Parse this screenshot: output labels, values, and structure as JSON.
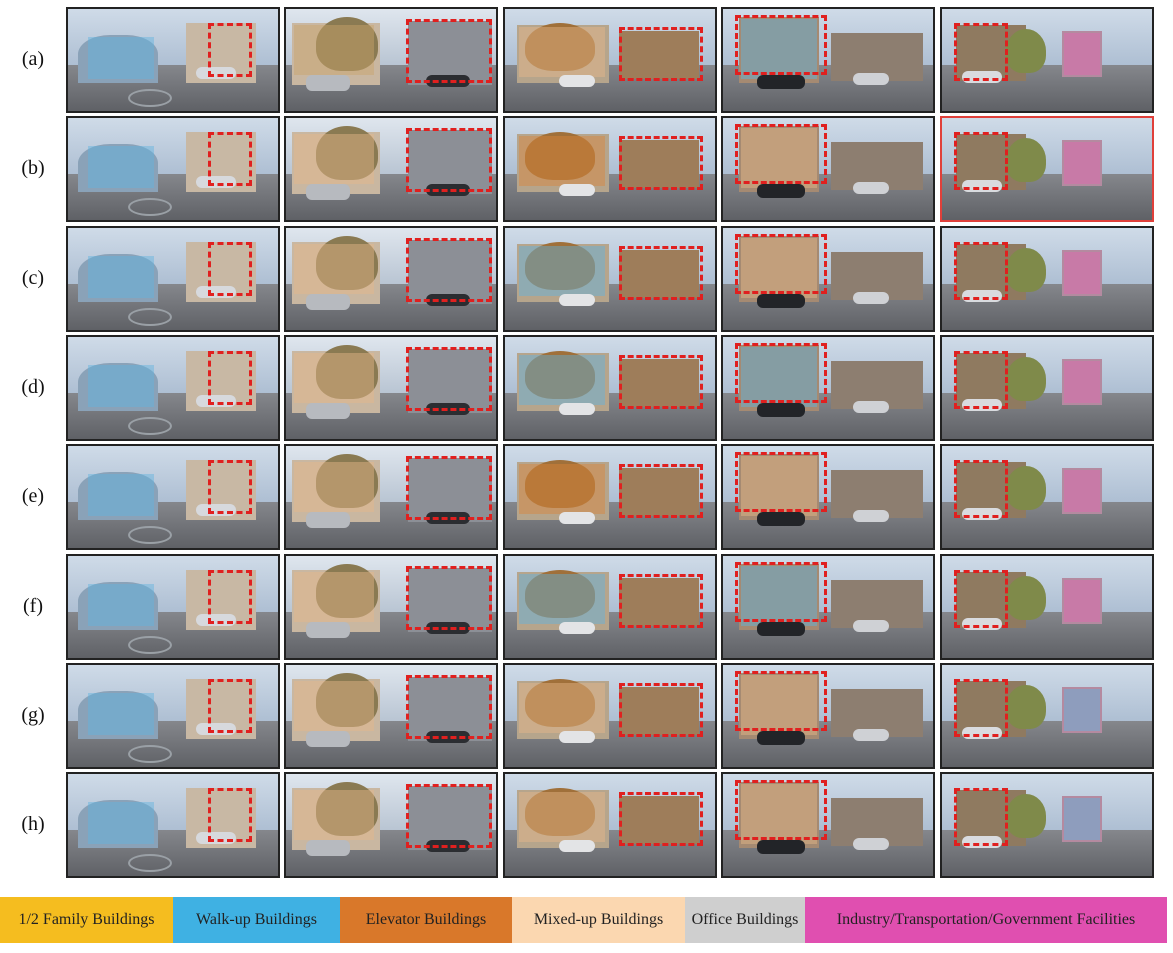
{
  "rows": [
    {
      "label": "(a)"
    },
    {
      "label": "(b)"
    },
    {
      "label": "(c)"
    },
    {
      "label": "(d)"
    },
    {
      "label": "(e)"
    },
    {
      "label": "(f)"
    },
    {
      "label": "(g)"
    },
    {
      "label": "(h)"
    }
  ],
  "highlighted_panel": {
    "row": 1,
    "col": 4
  },
  "panel_tints": [
    [
      "#5fb3e0",
      "#c9a36b",
      "#e6b98a",
      "#5fb3e0",
      "#e066b0"
    ],
    [
      "#5fb3e0",
      "#e6b98a",
      "#d9843a",
      "#e6b98a",
      "#e066b0"
    ],
    [
      "#5fb3e0",
      "#e6b98a",
      "#5fb3e0",
      "#e6b98a",
      "#e066b0"
    ],
    [
      "#5fb3e0",
      "#e6b98a",
      "#5fb3e0",
      "#5fb3e0",
      "#e066b0"
    ],
    [
      "#5fb3e0",
      "#e6b98a",
      "#d9843a",
      "#e6b98a",
      "#e066b0"
    ],
    [
      "#5fb3e0",
      "#e6b98a",
      "#5fb3e0",
      "#5fb3e0",
      "#e066b0"
    ],
    [
      "#5fb3e0",
      "#e6b98a",
      "#e6b98a",
      "#e6b98a",
      "#5fb3e0"
    ],
    [
      "#5fb3e0",
      "#e6b98a",
      "#e6b98a",
      "#e6b98a",
      "#5fb3e0"
    ]
  ],
  "legend": [
    {
      "label": "1/2 Family Buildings",
      "color": "#f5bd1f"
    },
    {
      "label": "Walk-up Buildings",
      "color": "#3fb1e3"
    },
    {
      "label": "Elevator Buildings",
      "color": "#d9782a"
    },
    {
      "label": "Mixed-up Buildings",
      "color": "#fbd7b0"
    },
    {
      "label": "Office Buildings",
      "color": "#cfcfcf"
    },
    {
      "label": "Industry/Transportation/Government Facilities",
      "color": "#e04fb0"
    }
  ]
}
